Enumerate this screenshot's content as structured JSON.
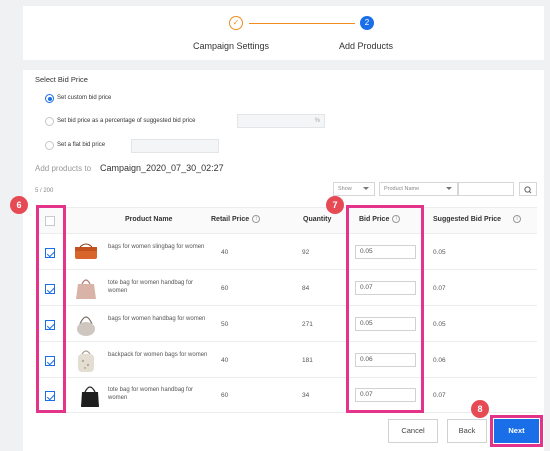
{
  "stepper": {
    "step1_label": "Campaign Settings",
    "step1_icon": "check-icon",
    "step2_label": "Add Products",
    "step2_number": "2"
  },
  "bid_price": {
    "title": "Select Bid Price",
    "options": [
      {
        "label": "Set custom bid price",
        "selected": true
      },
      {
        "label": "Set bid price as a percentage of suggested bid price",
        "selected": false,
        "suffix": "%"
      },
      {
        "label": "Set a flat bid price",
        "selected": false
      }
    ]
  },
  "add_products": {
    "prefix": "Add products to",
    "campaign_name": "Campaign_2020_07_30_02:27"
  },
  "filter": {
    "count": "5 / 200",
    "show_label": "Show",
    "field_label": "Product Name",
    "search_icon": "search-icon"
  },
  "table": {
    "headers": {
      "product_name": "Product Name",
      "retail_price": "Retail Price",
      "quantity": "Quantity",
      "bid_price": "Bid Price",
      "suggested_bid_price": "Suggested Bid Price"
    },
    "rows": [
      {
        "checked": true,
        "name": "bags for women slingbag for women",
        "retail_price": "40",
        "quantity": "92",
        "bid_price": "0.05",
        "suggested": "0.05"
      },
      {
        "checked": true,
        "name": "tote bag for women handbag for women",
        "retail_price": "60",
        "quantity": "84",
        "bid_price": "0.07",
        "suggested": "0.07"
      },
      {
        "checked": true,
        "name": "bags for women handbag for women",
        "retail_price": "50",
        "quantity": "271",
        "bid_price": "0.05",
        "suggested": "0.05"
      },
      {
        "checked": true,
        "name": "backpack for women bags for women",
        "retail_price": "40",
        "quantity": "181",
        "bid_price": "0.06",
        "suggested": "0.06"
      },
      {
        "checked": true,
        "name": "tote bag for women handbag for women",
        "retail_price": "60",
        "quantity": "34",
        "bid_price": "0.07",
        "suggested": "0.07"
      }
    ]
  },
  "buttons": {
    "cancel": "Cancel",
    "back": "Back",
    "next": "Next"
  },
  "annotations": {
    "badge_6": "6",
    "badge_7": "7",
    "badge_8": "8",
    "highlight_color": "#e4338a",
    "badge_color": "#e64b55"
  },
  "colors": {
    "accent": "#1a6fe8",
    "step_done": "#f08c1f"
  }
}
